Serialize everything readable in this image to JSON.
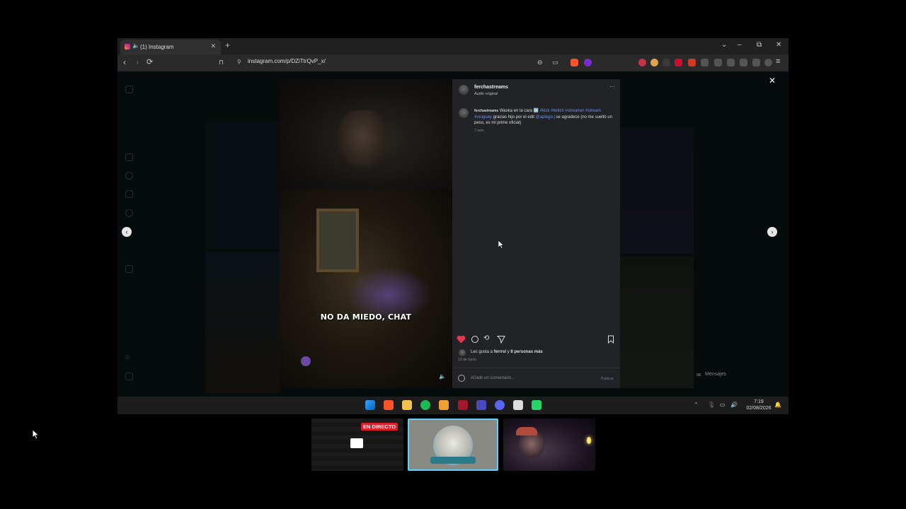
{
  "browser": {
    "tab_title": "(1) Instagram",
    "tab_sound_icon": "speaker-icon",
    "url": "instagram.com/p/DZiTtrQvP_x/",
    "window_controls": [
      "⌄",
      "–",
      "⧉",
      "✕"
    ]
  },
  "post": {
    "username": "ferchastreams",
    "audio": "Audio original",
    "caption_user": "ferchastreams",
    "caption_text_1": "Waska en la cara",
    "caption_tags_1": "#kick #twitch #streamer #stream #uruguay",
    "caption_text_2": "gracias hijo por el edit",
    "caption_mention": "@aplego.j",
    "caption_text_3": "se agradece (no me sueltó un peso, es mi prime oficial)",
    "time_ago": "7 sem",
    "video_caption": "NO DA MIEDO, CHAT",
    "likes_prefix": "Les gusta a ",
    "likes_user": "ferrrsl",
    "likes_middle": " y ",
    "likes_others": "8 personas más",
    "date": "13 de Junio",
    "comment_placeholder": "Añade un comentario...",
    "publish_label": "Publicar",
    "liked_color": "#e8364a"
  },
  "overlay": {
    "messages_label": "Mensajes"
  },
  "taskbar": {
    "time": "7:19",
    "date": "02/08/2026"
  },
  "stream": {
    "live_label": "EN DIRECTO"
  }
}
